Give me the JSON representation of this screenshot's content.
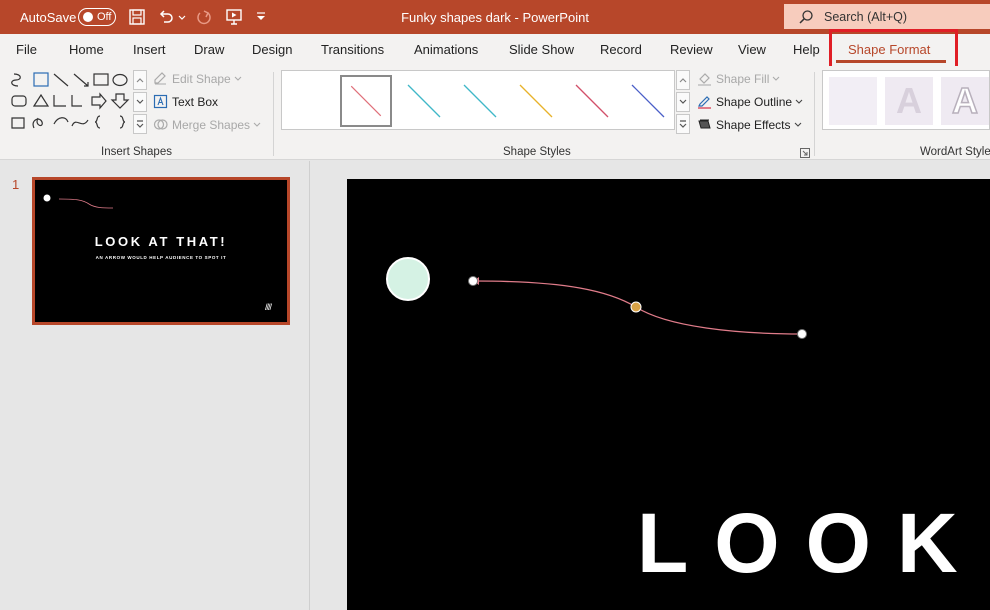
{
  "titlebar": {
    "autosave_label": "AutoSave",
    "autosave_state": "Off",
    "doc_title": "Funky shapes dark  -  PowerPoint",
    "search_placeholder": "Search (Alt+Q)",
    "bg_color": "#b7472a"
  },
  "tabs": [
    {
      "label": "File"
    },
    {
      "label": "Home"
    },
    {
      "label": "Insert"
    },
    {
      "label": "Draw"
    },
    {
      "label": "Design"
    },
    {
      "label": "Transitions"
    },
    {
      "label": "Animations"
    },
    {
      "label": "Slide Show"
    },
    {
      "label": "Record"
    },
    {
      "label": "Review"
    },
    {
      "label": "View"
    },
    {
      "label": "Help"
    },
    {
      "label": "Shape Format",
      "active": true
    }
  ],
  "ribbon": {
    "insert_shapes": {
      "group_label": "Insert Shapes",
      "edit_shape": "Edit Shape",
      "text_box": "Text Box",
      "merge_shapes": "Merge Shapes"
    },
    "shape_styles": {
      "group_label": "Shape Styles",
      "shape_fill": "Shape Fill",
      "shape_outline": "Shape Outline",
      "shape_effects": "Shape Effects",
      "line_colors": [
        "#e0707a",
        "#3fb8c8",
        "#3fb8c8",
        "#e8b22a",
        "#d2506a",
        "#4b5fc8"
      ]
    },
    "wordart": {
      "group_label": "WordArt Styles",
      "sample_letter": "A"
    }
  },
  "thumbnails": [
    {
      "number": "1",
      "title": "LOOK AT THAT!",
      "subtitle": "AN ARROW WOULD HELP AUDIENCE TO SPOT IT"
    }
  ],
  "slide": {
    "big_text": "LOOK",
    "accent_circle_color": "#d5f2e4",
    "connector_color": "#e07c8a",
    "adjust_handle_color": "#d9a246"
  }
}
